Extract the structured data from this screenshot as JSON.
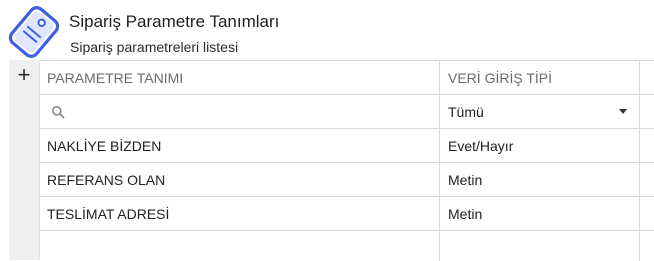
{
  "header": {
    "title": "Sipariş Parametre Tanımları",
    "subtitle": "Sipariş parametreleri listesi",
    "icon": "tag-icon",
    "accent": "#3f5fe0"
  },
  "toolbar": {
    "add_icon": "plus-icon",
    "add_symbol": "+"
  },
  "grid": {
    "columns": [
      "PARAMETRE TANIMI",
      "VERİ GİRİŞ TİPİ"
    ],
    "filter": {
      "search_value": "",
      "type_selected": "Tümü"
    },
    "rows": [
      {
        "name": "NAKLİYE BİZDEN",
        "type": "Evet/Hayır"
      },
      {
        "name": "REFERANS OLAN",
        "type": "Metin"
      },
      {
        "name": "TESLİMAT ADRESİ",
        "type": "Metin"
      }
    ]
  }
}
